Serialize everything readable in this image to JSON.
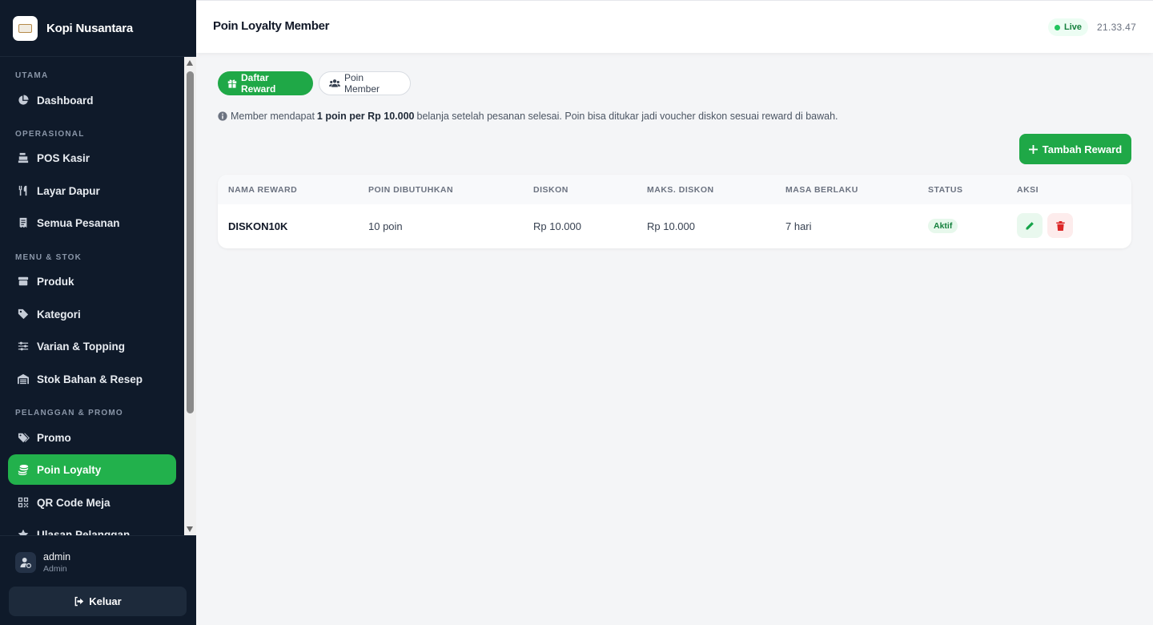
{
  "brand": {
    "name": "Kopi Nusantara",
    "logo_icon": "coffee-logo-icon"
  },
  "sidebar": {
    "sections": [
      {
        "title": "UTAMA"
      },
      {
        "title": "OPERASIONAL"
      },
      {
        "title": "MENU & STOK"
      },
      {
        "title": "PELANGGAN & PROMO"
      }
    ],
    "items": [
      {
        "label": "Dashboard",
        "icon": "pie-chart-icon"
      },
      {
        "label": "POS Kasir",
        "icon": "cash-register-icon"
      },
      {
        "label": "Layar Dapur",
        "icon": "utensils-icon"
      },
      {
        "label": "Semua Pesanan",
        "icon": "receipt-icon"
      },
      {
        "label": "Produk",
        "icon": "box-icon"
      },
      {
        "label": "Kategori",
        "icon": "tag-icon"
      },
      {
        "label": "Varian & Topping",
        "icon": "sliders-icon"
      },
      {
        "label": "Stok Bahan & Resep",
        "icon": "warehouse-icon"
      },
      {
        "label": "Promo",
        "icon": "tags-icon"
      },
      {
        "label": "Poin Loyalty",
        "icon": "coins-icon",
        "active": true
      },
      {
        "label": "QR Code Meja",
        "icon": "qrcode-icon"
      },
      {
        "label": "Ulasan Pelanggan",
        "icon": "star-icon"
      }
    ]
  },
  "user": {
    "name": "admin",
    "role": "Admin",
    "logout_label": "Keluar"
  },
  "header": {
    "title": "Poin Loyalty Member",
    "live_label": "Live",
    "time": "21.33.47"
  },
  "tabs": [
    {
      "label": "Daftar Reward",
      "icon": "gift-icon",
      "active": true
    },
    {
      "label": "Poin Member",
      "icon": "users-icon",
      "active": false
    }
  ],
  "info": {
    "prefix": "Member mendapat",
    "highlight": "1 poin per Rp 10.000",
    "suffix": "belanja setelah pesanan selesai. Poin bisa ditukar jadi voucher diskon sesuai reward di bawah."
  },
  "add_button_label": "Tambah Reward",
  "table": {
    "columns": [
      "NAMA REWARD",
      "POIN DIBUTUHKAN",
      "DISKON",
      "MAKS. DISKON",
      "MASA BERLAKU",
      "STATUS",
      "AKSI"
    ],
    "rows": [
      {
        "name": "DISKON10K",
        "points": "10 poin",
        "discount": "Rp 10.000",
        "max_discount": "Rp 10.000",
        "validity": "7 hari",
        "status": "Aktif"
      }
    ]
  },
  "colors": {
    "sidebar_bg": "#0f1a2a",
    "accent_green": "#1fa847",
    "danger_red": "#dc2626"
  }
}
